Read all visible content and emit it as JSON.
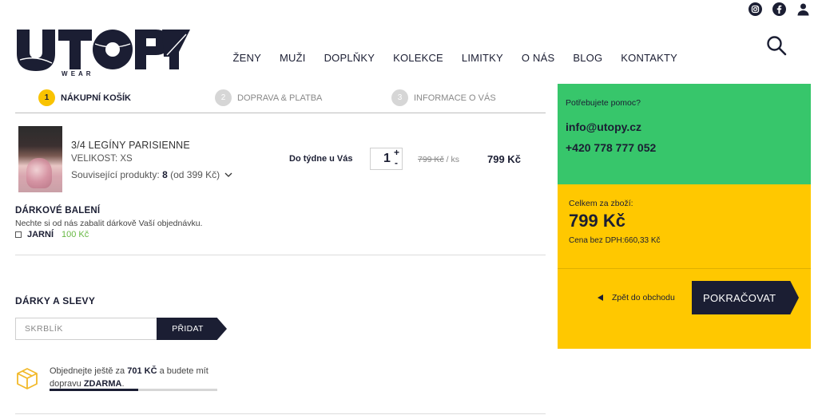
{
  "header": {
    "logo_word": "UTOPY",
    "logo_sub": "W E A R",
    "nav": [
      "ŽENY",
      "MUŽI",
      "DOPLŇKY",
      "KOLEKCE",
      "LIMITKY",
      "O NÁS",
      "BLOG",
      "KONTAKTY"
    ],
    "icons": [
      "instagram-icon",
      "facebook-icon",
      "user-icon",
      "search-icon"
    ]
  },
  "steps": [
    {
      "num": "1",
      "label": "NÁKUPNÍ KOŠÍK"
    },
    {
      "num": "2",
      "label": "DOPRAVA & PLATBA"
    },
    {
      "num": "3",
      "label": "INFORMACE O VÁS"
    }
  ],
  "cart_item": {
    "name": "3/4 LEGÍNY PARISIENNE",
    "size": "VELIKOST: XS",
    "related_label": "Související produkty:",
    "related_count": "8",
    "related_from": "(od 399 Kč)",
    "delivery": "Do týdne u Vás",
    "quantity": "1",
    "plus": "+",
    "minus": "-",
    "unit_price": "799 Kč",
    "per_unit": "/ ks",
    "total_price": "799 Kč"
  },
  "gift": {
    "title": "DÁRKOVÉ BALENÍ",
    "desc": "Nechte si od nás zabalit dárkově Vaší objednávku.",
    "option_label": "JARNÍ",
    "option_price": "100 Kč"
  },
  "discounts": {
    "title": "DÁRKY A SLEVY",
    "placeholder": "SKRBLÍK",
    "button": "PŘIDAT"
  },
  "shipping": {
    "text1": "Objednejte ještě za",
    "amount": "701 KČ",
    "text2": "a budete mít dopravu",
    "free": "ZDARMA",
    "dot": ".",
    "progress": 0.53
  },
  "help": {
    "question": "Potřebujete pomoc?",
    "email": "info@utopy.cz",
    "phone": "+420 778 777 052"
  },
  "summary": {
    "label": "Celkem za zboží:",
    "amount": "799 Kč",
    "vat": "Cena bez DPH:660,33 Kč",
    "back": "Zpět do obchodu",
    "continue": "POKRAČOVAT"
  },
  "colors": {
    "navy": "#1b1e33",
    "yellow": "#ffc800",
    "green": "#37c66b",
    "step_active": "#f9c300"
  }
}
